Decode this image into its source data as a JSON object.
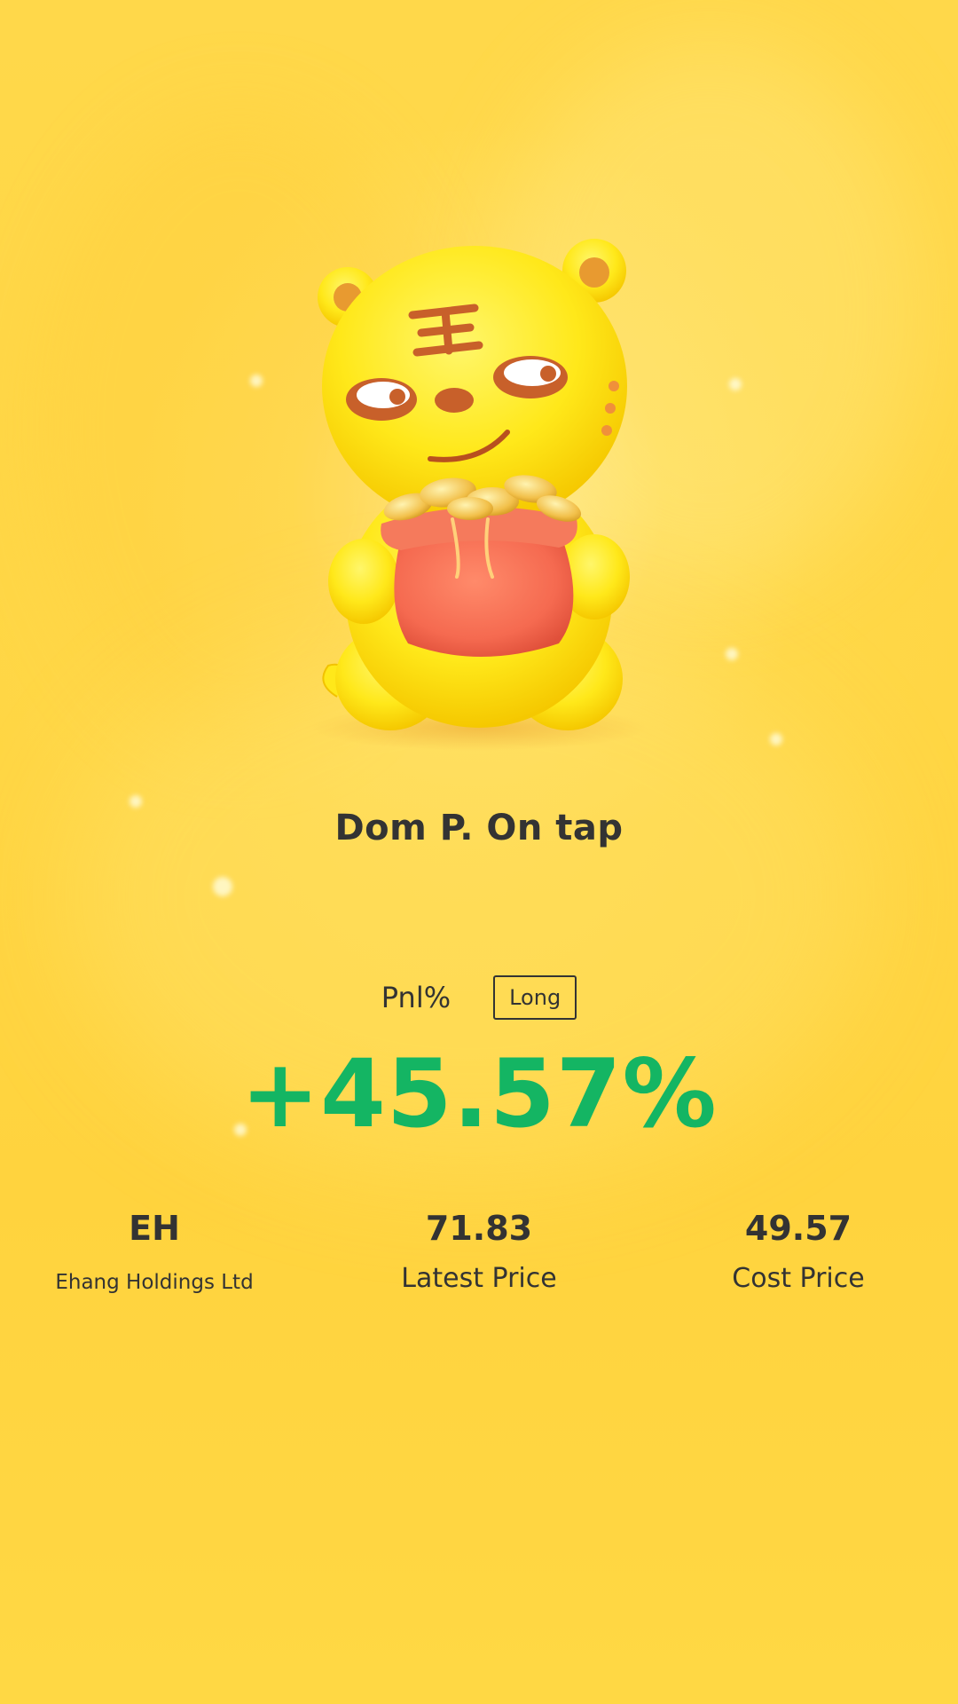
{
  "user": {
    "name": "Dom P. On tap"
  },
  "position": {
    "pnl_label": "Pnl%",
    "direction": "Long",
    "pnl_value": "+45.57%",
    "pnl_color": "#14b563"
  },
  "stats": {
    "ticker": "EH",
    "company_name": "Ehang Holdings Ltd",
    "latest_price": "71.83",
    "latest_price_label": "Latest Price",
    "cost_price": "49.57",
    "cost_price_label": "Cost Price"
  },
  "mascot": {
    "icon": "tiger-mascot-money-bag-icon",
    "forehead_glyph": "王"
  },
  "colors": {
    "background": "#ffd644",
    "text": "#333333",
    "mascot_body": "#ffe81a",
    "money_bag": "#f56a50"
  }
}
